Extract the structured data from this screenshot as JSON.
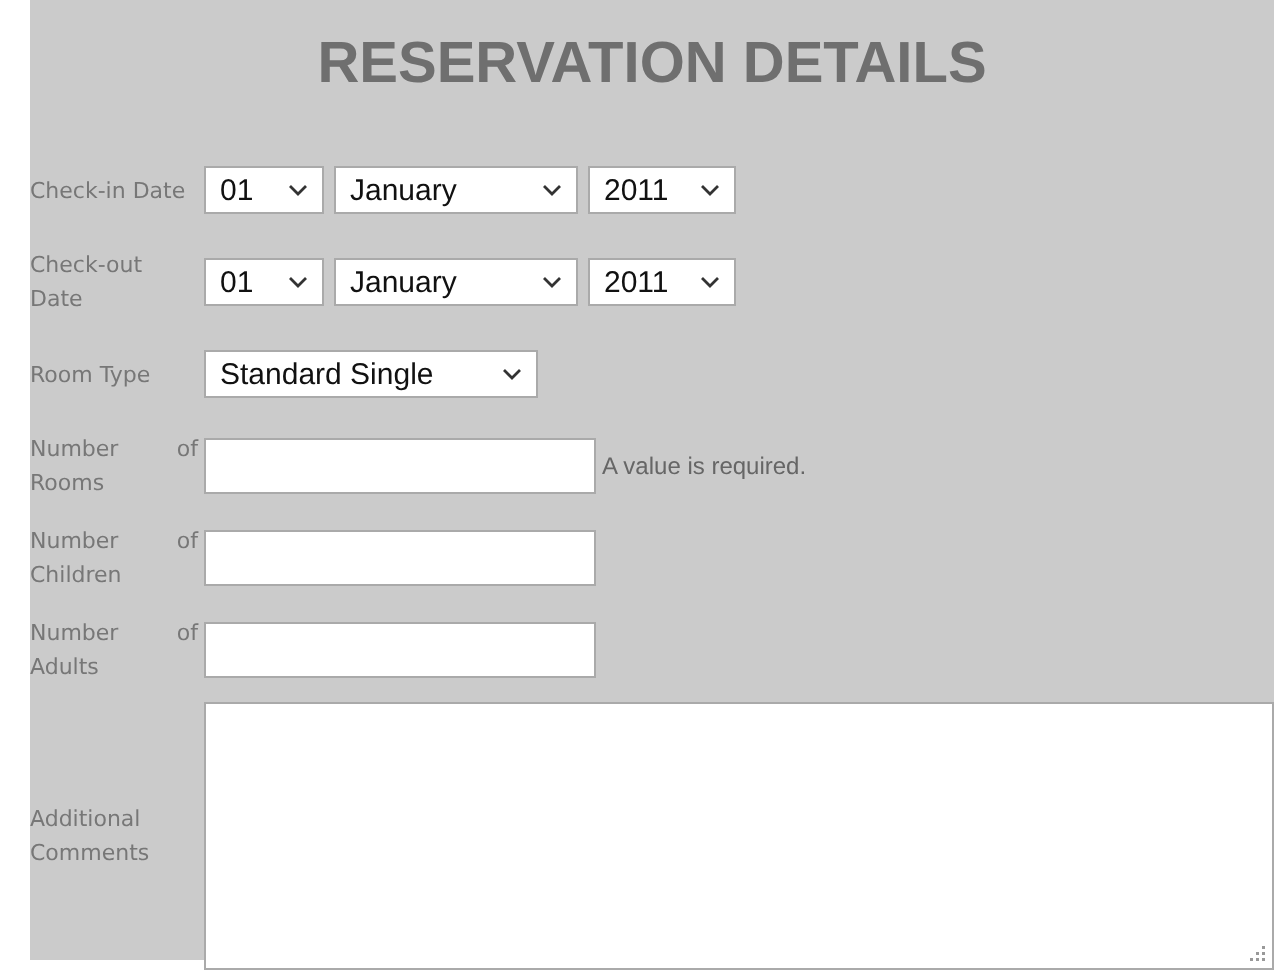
{
  "title": "RESERVATION DETAILS",
  "fields": [
    {
      "kind": "date",
      "label": "Check-in Date",
      "selects": [
        "01",
        "January",
        "2011"
      ]
    },
    {
      "kind": "date",
      "label": "Check-out Date",
      "selects": [
        "01",
        "January",
        "2011"
      ]
    },
    {
      "kind": "select",
      "label": "Room Type",
      "value": "Standard Single"
    },
    {
      "kind": "text",
      "label": "Number of Rooms",
      "message": "A value is required."
    },
    {
      "kind": "text",
      "label": "Number of Children"
    },
    {
      "kind": "text",
      "label": "Number of Adults"
    },
    {
      "kind": "textarea",
      "label": "Additional Comments"
    }
  ]
}
